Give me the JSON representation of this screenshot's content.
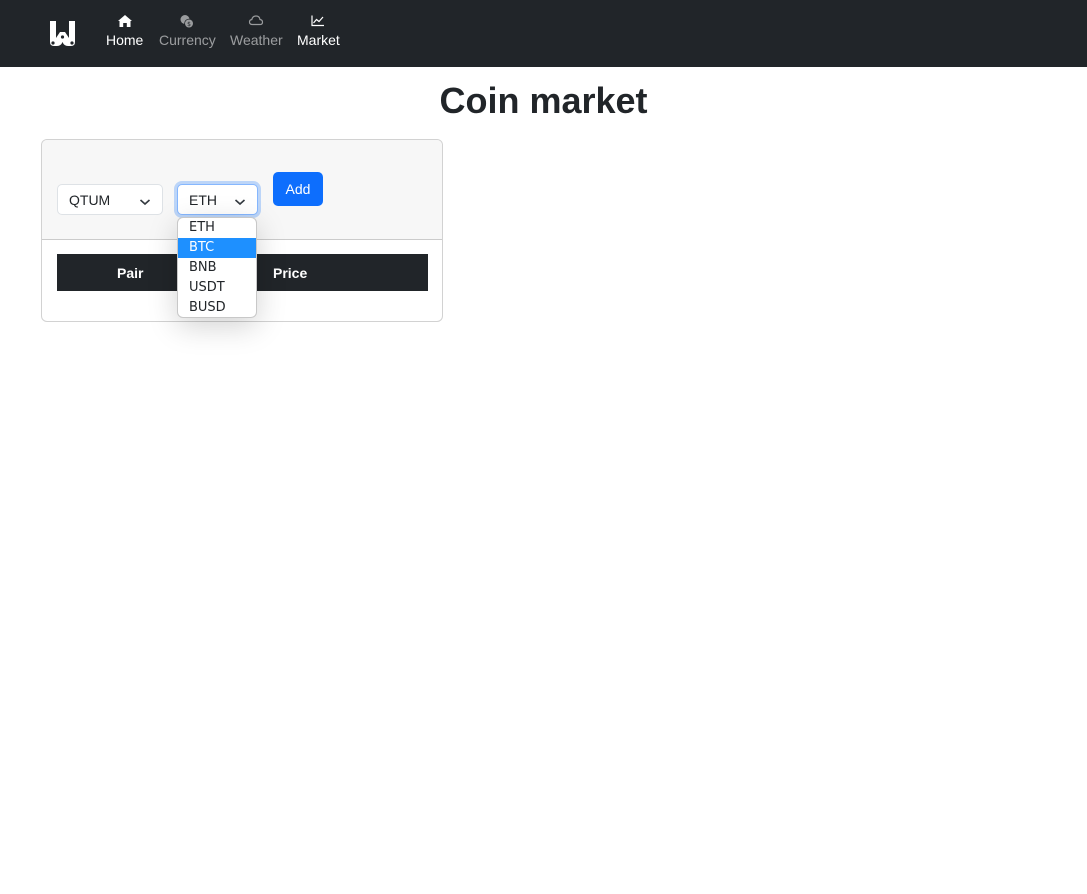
{
  "nav": {
    "items": [
      {
        "label": "Home",
        "icon": "house-icon"
      },
      {
        "label": "Currency",
        "icon": "coins-icon"
      },
      {
        "label": "Weather",
        "icon": "cloud-icon"
      },
      {
        "label": "Market",
        "icon": "chart-line-icon"
      }
    ],
    "active": "Market"
  },
  "page": {
    "title": "Coin market"
  },
  "form": {
    "base_select": {
      "value": "QTUM"
    },
    "quote_select": {
      "value": "ETH",
      "options": [
        "ETH",
        "BTC",
        "BNB",
        "USDT",
        "BUSD"
      ],
      "highlighted": "BTC"
    },
    "add_label": "Add"
  },
  "table": {
    "columns": [
      "Pair",
      "Price"
    ],
    "rows": []
  },
  "colors": {
    "navbar": "#212529",
    "primary": "#0d6efd",
    "highlight": "#1e90ff"
  }
}
